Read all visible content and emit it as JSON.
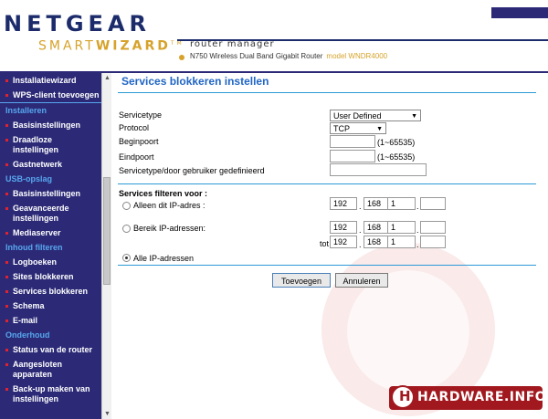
{
  "header": {
    "brand": "NETGEAR",
    "smart": "SMART",
    "wizard": "WIZARD",
    "tm": "TM",
    "router_manager": "router manager",
    "router_desc": "N750 Wireless Dual Band Gigabit Router",
    "model": "model WNDR4000",
    "colors": {
      "navy": "#2c2a77",
      "gold": "#d6a22a"
    }
  },
  "sidebar": {
    "items": [
      {
        "label": "Installatiewizard",
        "type": "item"
      },
      {
        "label": "WPS-client toevoegen",
        "type": "item"
      },
      {
        "label": "Installeren",
        "type": "section"
      },
      {
        "label": "Basisinstellingen",
        "type": "item"
      },
      {
        "label": "Draadloze instellingen",
        "type": "item"
      },
      {
        "label": "Gastnetwerk",
        "type": "item"
      },
      {
        "label": "USB-opslag",
        "type": "section"
      },
      {
        "label": "Basisinstellingen",
        "type": "item"
      },
      {
        "label": "Geavanceerde instellingen",
        "type": "item"
      },
      {
        "label": "Mediaserver",
        "type": "item"
      },
      {
        "label": "Inhoud filteren",
        "type": "section"
      },
      {
        "label": "Logboeken",
        "type": "item"
      },
      {
        "label": "Sites blokkeren",
        "type": "item"
      },
      {
        "label": "Services blokkeren",
        "type": "item"
      },
      {
        "label": "Schema",
        "type": "item"
      },
      {
        "label": "E-mail",
        "type": "item"
      },
      {
        "label": "Onderhoud",
        "type": "section"
      },
      {
        "label": "Status van de router",
        "type": "item"
      },
      {
        "label": "Aangesloten apparaten",
        "type": "item"
      },
      {
        "label": "Back-up maken van instellingen",
        "type": "item"
      }
    ]
  },
  "main": {
    "title": "Services blokkeren instellen",
    "servicetype_label": "Servicetype",
    "servicetype_value": "User Defined",
    "protocol_label": "Protocol",
    "protocol_value": "TCP",
    "beginpoort_label": "Beginpoort",
    "beginpoort_range": "(1~65535)",
    "eindpoort_label": "Eindpoort",
    "eindpoort_range": "(1~65535)",
    "userdef_label": "Servicetype/door gebruiker gedefinieerd",
    "filter_heading": "Services filteren voor :",
    "only_ip_label": "Alleen dit IP-adres :",
    "only_ip": [
      "192",
      "168",
      "1",
      ""
    ],
    "range_label": "Bereik IP-adressen:",
    "range_from": [
      "192",
      "168",
      "1",
      ""
    ],
    "tot_label": "tot",
    "range_to": [
      "192",
      "168",
      "1",
      ""
    ],
    "all_ip_label": "Alle IP-adressen",
    "selected_radio": "all",
    "add_button": "Toevoegen",
    "cancel_button": "Annuleren"
  },
  "watermark": {
    "text": "HARDWARE.INFO",
    "badge_letter": "H"
  }
}
